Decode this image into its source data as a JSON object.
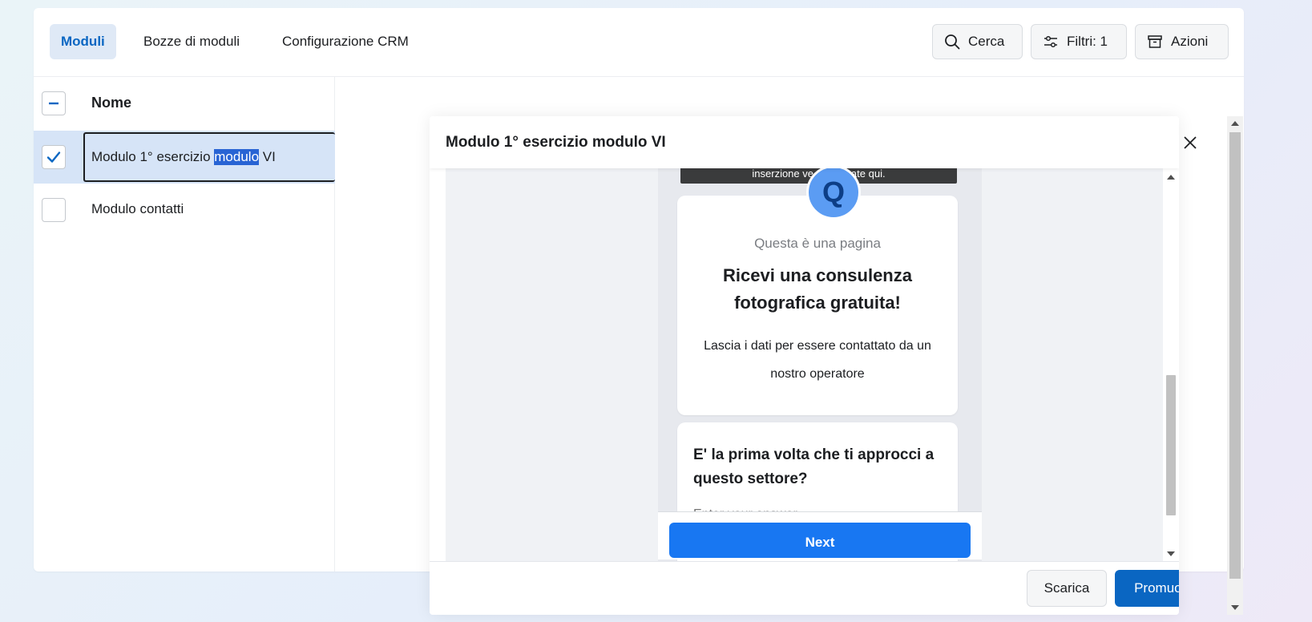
{
  "tabs": [
    {
      "label": "Moduli",
      "active": true
    },
    {
      "label": "Bozze di moduli",
      "active": false
    },
    {
      "label": "Configurazione CRM",
      "active": false
    }
  ],
  "toolbar": {
    "search_label": "Cerca",
    "filter_label": "Filtri: 1",
    "actions_label": "Azioni",
    "search_icon": "search-icon",
    "filter_icon": "sliders-icon",
    "actions_icon": "archive-icon"
  },
  "list": {
    "column_title": "Nome",
    "rows": [
      {
        "name_before": "Modulo 1° esercizio ",
        "name_selected": "modulo",
        "name_after": " VI",
        "checked": true
      },
      {
        "name": "Modulo contatti",
        "checked": false
      }
    ]
  },
  "modal": {
    "title": "Modulo 1° esercizio modulo VI",
    "preview": {
      "notice": "inserzione ve... mostrate qui.",
      "avatar_letter": "Q",
      "page_subtitle": "Questa è una pagina",
      "headline": "Ricevi una consulenza fotografica gratuita!",
      "description": "Lascia i dati per essere contattato da un nostro operatore",
      "question": "E' la prima volta che ti approcci a questo settore?",
      "answer_placeholder": "Enter your answer",
      "next_label": "Next"
    },
    "download_label": "Scarica",
    "promote_label": "Promuovi"
  },
  "colors": {
    "accent": "#0a66c2",
    "primary_button": "#1877f2",
    "selected_row": "#d6e4f7"
  }
}
